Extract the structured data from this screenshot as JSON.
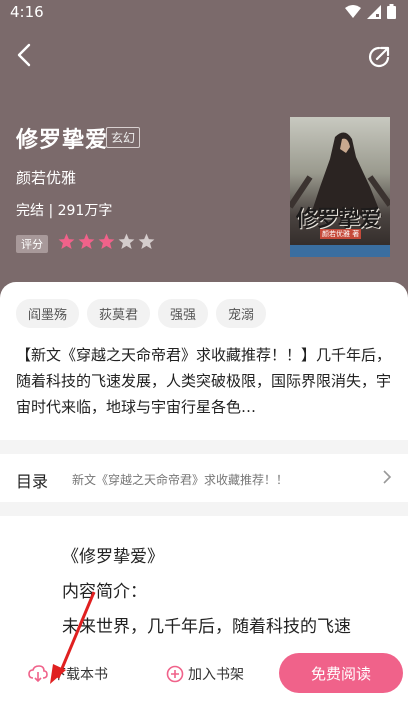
{
  "status_bar": {
    "time": "4:16"
  },
  "book": {
    "title": "修罗挚爱",
    "genre": "玄幻",
    "author": "颜若优雅",
    "meta": "完结 | 291万字",
    "rating_label": "评分",
    "rating": 3,
    "rating_max": 5,
    "cover": {
      "title": "修罗挚爱",
      "author": "颜若优雅 著"
    }
  },
  "tags": [
    "阎墨殇",
    "荻莫君",
    "强强",
    "宠溺"
  ],
  "synopsis": "【新文《穿越之天命帝君》求收藏推荐！！】几千年后，随着科技的飞速发展，人类突破极限，国际界限消失，宇宙时代来临，地球与宇宙行星各色…",
  "toc": {
    "label": "目录",
    "latest": "新文《穿越之天命帝君》求收藏推荐！！"
  },
  "content": {
    "line1": "《修罗挚爱》",
    "line2": "内容简介：",
    "line3": "未来世界，几千年后，随着科技的飞速"
  },
  "bottom_bar": {
    "download": "下载本书",
    "add_shelf": "加入书架",
    "read": "免费阅读"
  },
  "colors": {
    "header_bg": "#7b6a6b",
    "accent": "#f0628a",
    "star_filled": "#f0628a",
    "star_empty": "#d4cccc",
    "annotation_arrow": "#e02020"
  }
}
